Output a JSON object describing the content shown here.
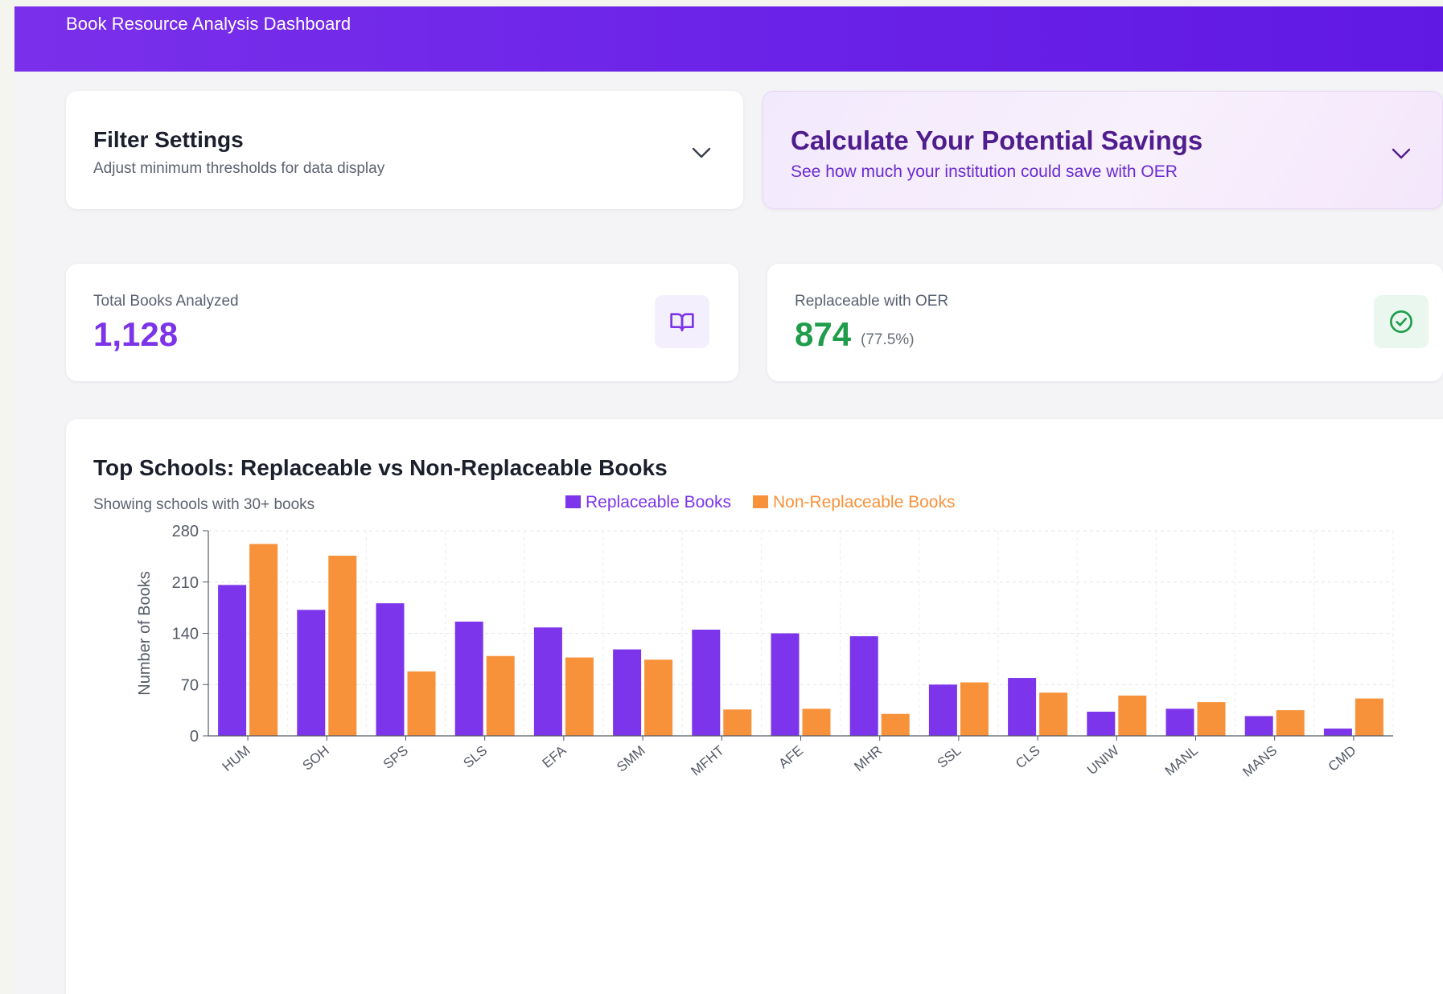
{
  "header": {
    "title": "Book Resource Analysis Dashboard"
  },
  "filter": {
    "title": "Filter Settings",
    "subtitle": "Adjust minimum thresholds for data display"
  },
  "savings": {
    "title": "Calculate Your Potential Savings",
    "subtitle": "See how much your institution could save with OER"
  },
  "stats": {
    "total": {
      "label": "Total Books Analyzed",
      "value": "1,128",
      "icon": "book-open-icon"
    },
    "replaceable": {
      "label": "Replaceable with OER",
      "value": "874",
      "pct": "(77.5%)",
      "icon": "check-circle-icon"
    }
  },
  "colors": {
    "accent": "#7c34e8",
    "replaceable": "#7c35eb",
    "non_replaceable": "#f8923a",
    "success": "#1f9d4b"
  },
  "chart": {
    "title": "Top Schools: Replaceable vs Non-Replaceable Books",
    "subtitle": "Showing schools with 30+ books"
  },
  "chart_data": {
    "type": "bar",
    "categories": [
      "HUM",
      "SOH",
      "SPS",
      "SLS",
      "EFA",
      "SMM",
      "MFHT",
      "AFE",
      "MHR",
      "SSL",
      "CLS",
      "UNIW",
      "MANL",
      "MANS",
      "CMD"
    ],
    "series": [
      {
        "name": "Replaceable Books",
        "values": [
          206,
          172,
          181,
          156,
          148,
          118,
          145,
          140,
          136,
          70,
          79,
          33,
          37,
          27,
          10
        ]
      },
      {
        "name": "Non-Replaceable Books",
        "values": [
          262,
          246,
          88,
          109,
          107,
          104,
          36,
          37,
          30,
          73,
          59,
          55,
          46,
          35,
          51
        ]
      }
    ],
    "ylabel": "Number of Books",
    "xlabel": "",
    "ylim": [
      0,
      280
    ],
    "yticks": [
      0,
      70,
      140,
      210,
      280
    ],
    "grid": true,
    "legend": "top-center"
  }
}
